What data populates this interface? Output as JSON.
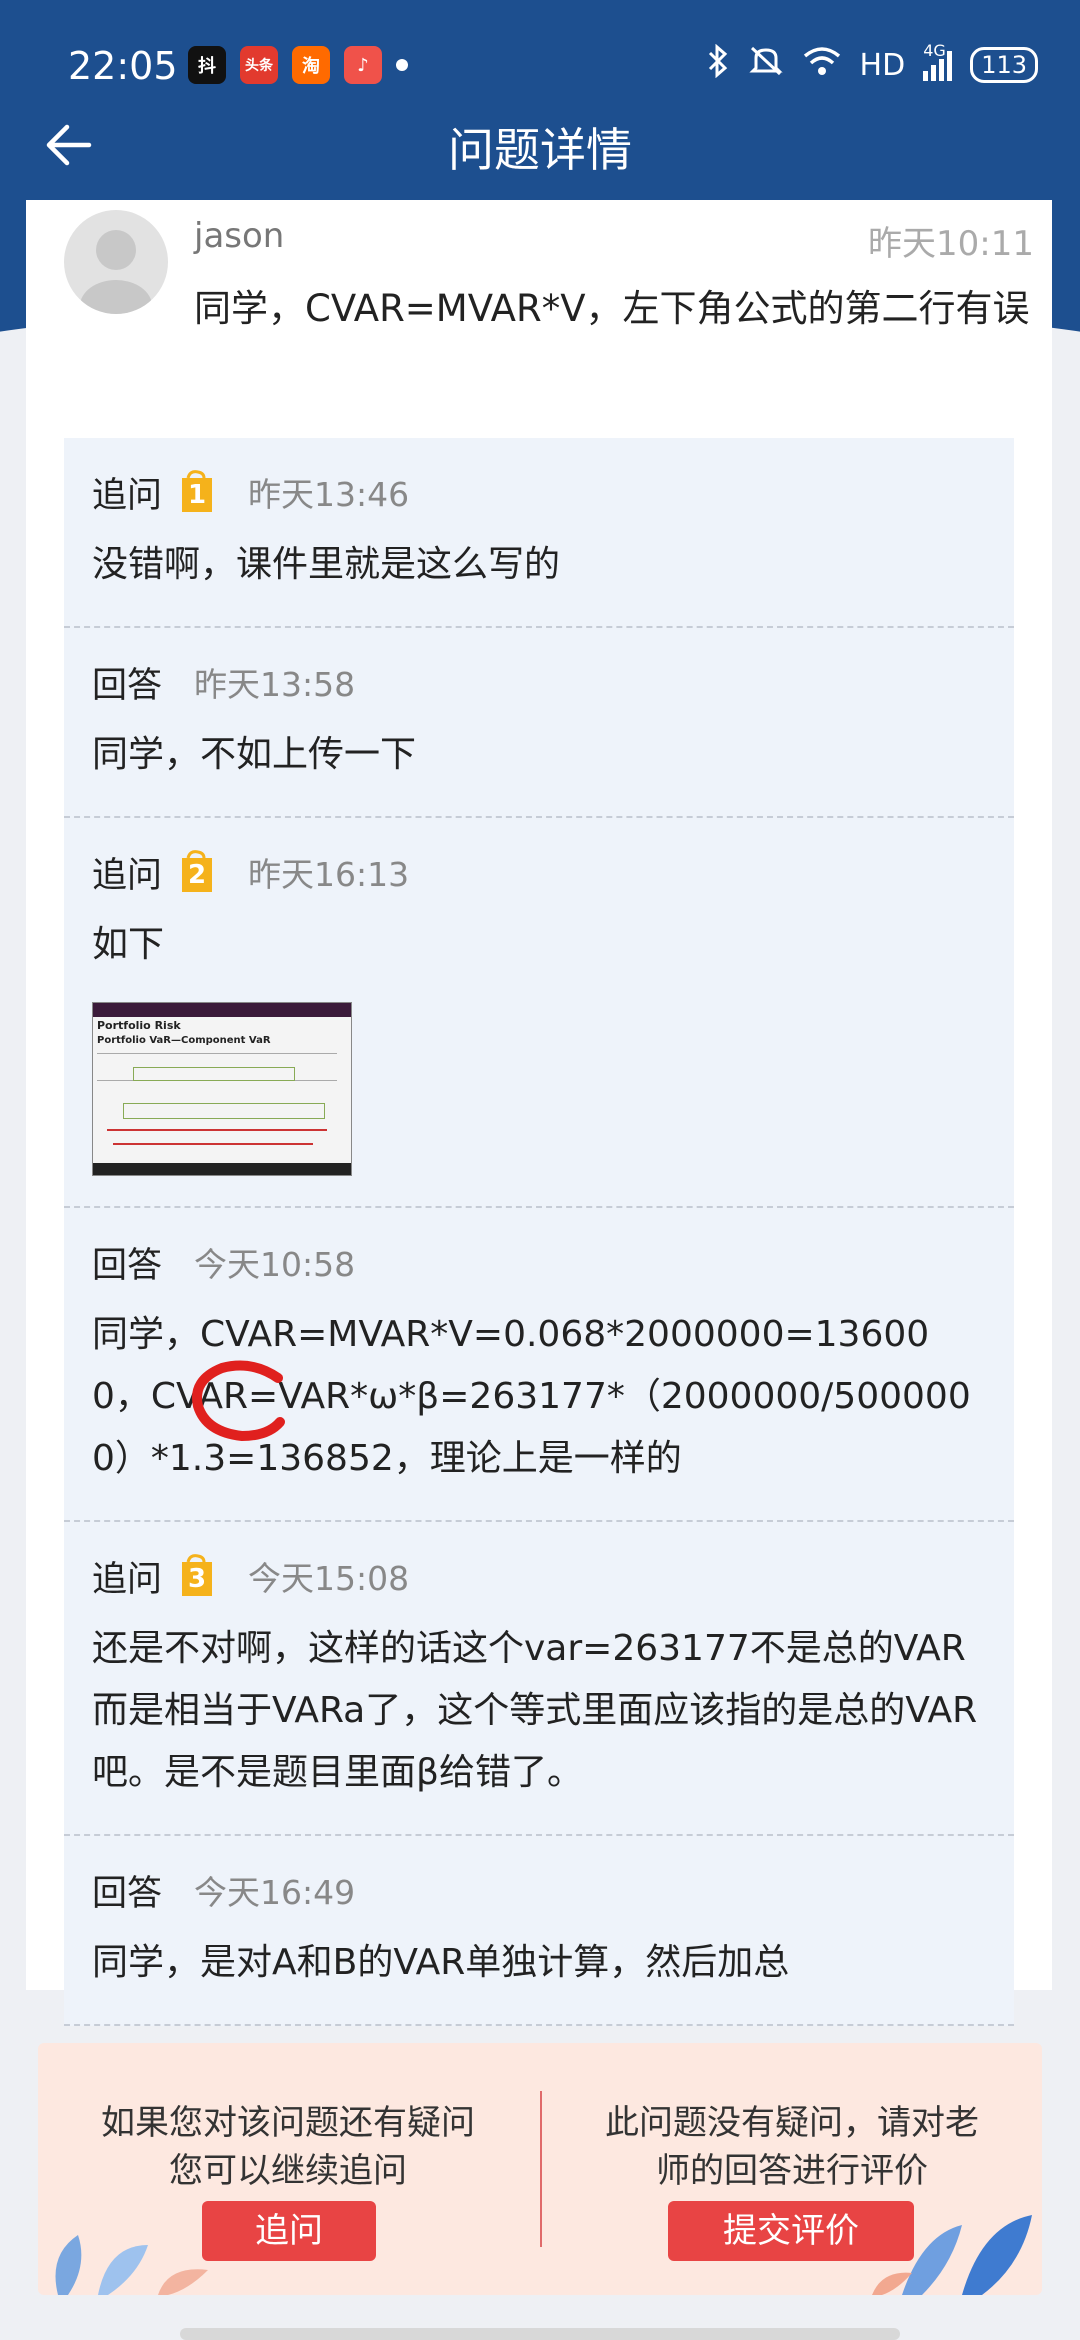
{
  "status_bar": {
    "time": "22:05",
    "apps": [
      "抖",
      "头条",
      "淘",
      "♪"
    ],
    "network": "HD",
    "signal": "4G",
    "battery": "113"
  },
  "header": {
    "title": "问题详情"
  },
  "question": {
    "user": "jason",
    "time": "昨天10:11",
    "text": "同学，CVAR=MVAR*V，左下角公式的第二行有误"
  },
  "thread": [
    {
      "kind": "追问",
      "badge": "1",
      "time": "昨天13:46",
      "text": "没错啊，课件里就是这么写的"
    },
    {
      "kind": "回答",
      "badge": "",
      "time": "昨天13:58",
      "text": "同学，不如上传一下"
    },
    {
      "kind": "追问",
      "badge": "2",
      "time": "昨天16:13",
      "text": "如下",
      "image": {
        "heading": "Portfolio Risk",
        "subheading": "Portfolio VaR—Component VaR"
      }
    },
    {
      "kind": "回答",
      "badge": "",
      "time": "今天10:58",
      "text": "同学，CVAR=MVAR*V=0.068*2000000=136000，CVAR=VAR*ω*β=263177*（2000000/5000000）*1.3=136852，理论上是一样的"
    },
    {
      "kind": "追问",
      "badge": "3",
      "time": "今天15:08",
      "text": "还是不对啊，这样的话这个var=263177不是总的VAR而是相当于VARa了，这个等式里面应该指的是总的VAR吧。是不是题目里面β给错了。"
    },
    {
      "kind": "回答",
      "badge": "",
      "time": "今天16:49",
      "text": "同学，是对A和B的VAR单独计算，然后加总"
    }
  ],
  "footer": {
    "left_line1": "如果您对该问题还有疑问",
    "left_line2": "您可以继续追问",
    "left_button": "追问",
    "right_line1": "此问题没有疑问，请对老",
    "right_line2": "师的回答进行评价",
    "right_button": "提交评价"
  },
  "colors": {
    "header": "#1d4f8f",
    "thread_bg": "#eef3fa",
    "badge": "#f5b21b",
    "button": "#e84444"
  }
}
